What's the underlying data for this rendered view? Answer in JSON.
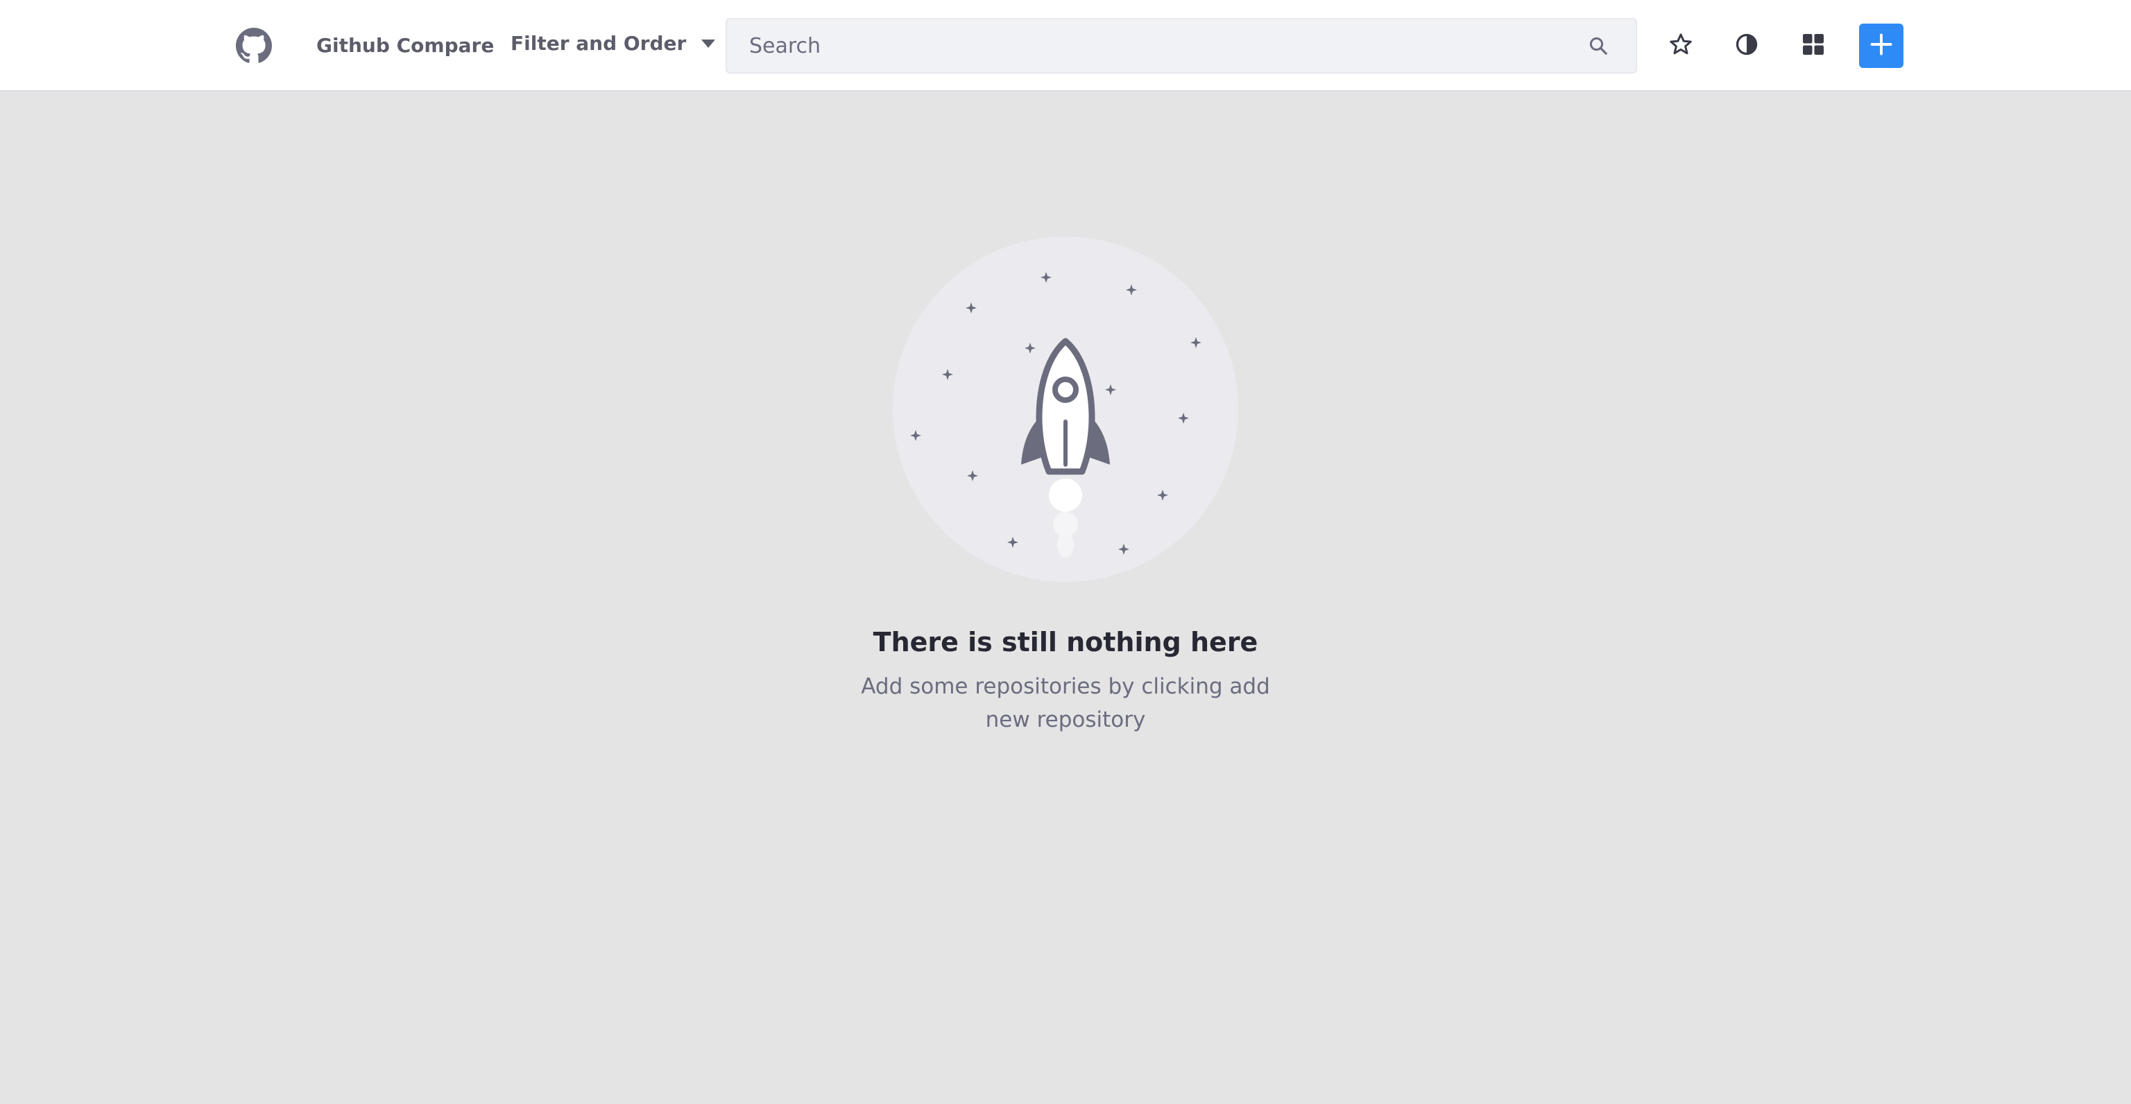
{
  "navbar": {
    "logo_icon": "github-icon",
    "brand_title": "Github Compare",
    "filter_label": "Filter and Order",
    "search": {
      "placeholder": "Search",
      "value": ""
    },
    "actions": [
      {
        "name": "star-icon",
        "label": "Favorites"
      },
      {
        "name": "contrast-icon",
        "label": "Toggle theme"
      },
      {
        "name": "grid-icon",
        "label": "Change view"
      },
      {
        "name": "plus-icon",
        "label": "Add new repository"
      }
    ]
  },
  "empty_state": {
    "illustration_icon": "rocket-icon",
    "title": "There is still nothing here",
    "description": "Add some repositories by clicking add new repository"
  },
  "colors": {
    "background": "#e4e4e5",
    "navbar": "#ffffff",
    "primary": "#2e8af5",
    "text_dark": "#272833",
    "text_muted": "#6b6c7e"
  }
}
